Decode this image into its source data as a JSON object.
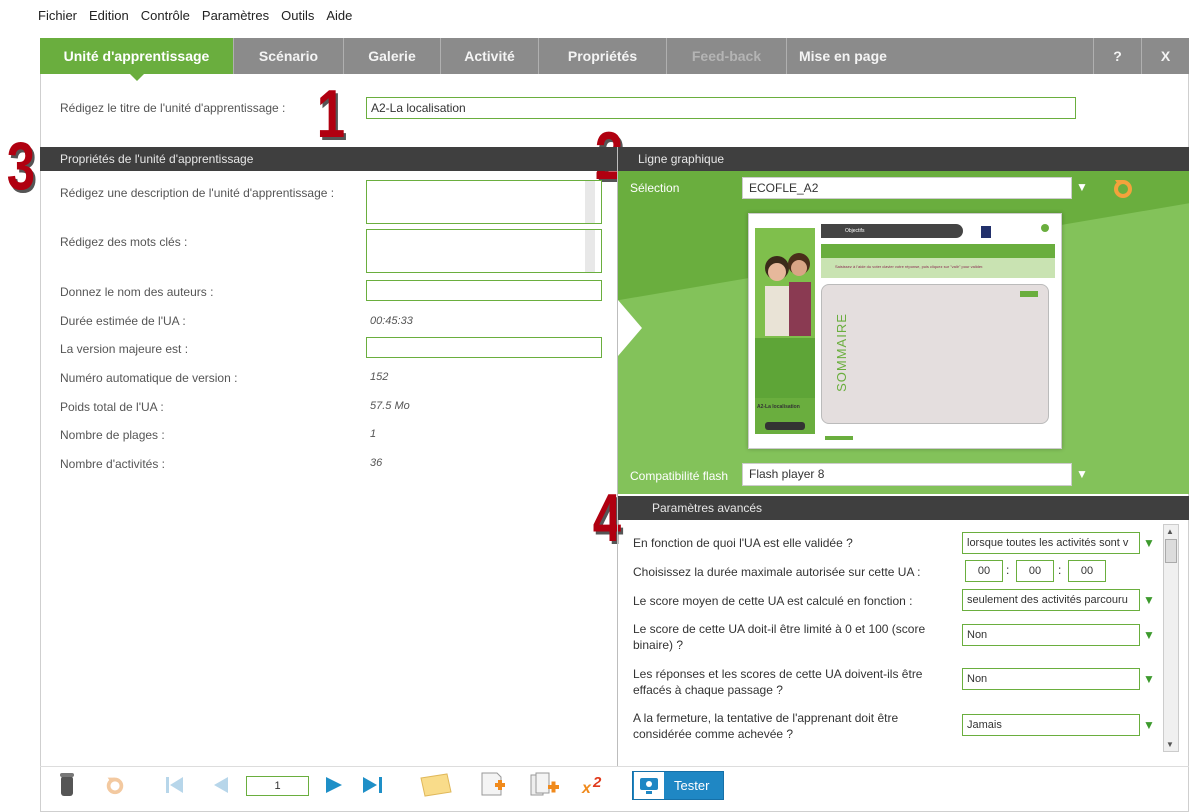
{
  "menu": [
    "Fichier",
    "Edition",
    "Contrôle",
    "Paramètres",
    "Outils",
    "Aide"
  ],
  "tabs": [
    {
      "label": "Unité d'apprentissage",
      "state": "active"
    },
    {
      "label": "Scénario",
      "state": "normal"
    },
    {
      "label": "Galerie",
      "state": "normal"
    },
    {
      "label": "Activité",
      "state": "normal"
    },
    {
      "label": "Propriétés",
      "state": "normal"
    },
    {
      "label": "Feed-back",
      "state": "disabled"
    },
    {
      "label": "Mise en page",
      "state": "normal"
    }
  ],
  "tab_help": "?",
  "tab_close": "X",
  "title_prompt": "Rédigez le titre de l'unité d'apprentissage :",
  "title_value": "A2-La localisation",
  "callouts": [
    "1",
    "2",
    "3",
    "4"
  ],
  "props": {
    "header": "Propriétés de l'unité d'apprentissage",
    "description_label": "Rédigez une description de l'unité d'apprentissage :",
    "keywords_label": "Rédigez des mots clés :",
    "authors_label": "Donnez le nom des auteurs :",
    "duration_label": "Durée estimée de l'UA :",
    "duration_value": "00:45:33",
    "major_label": "La version majeure est :",
    "autoversion_label": "Numéro automatique de version :",
    "autoversion_value": "152",
    "weight_label": "Poids total de l'UA :",
    "weight_value": "57.5 Mo",
    "ranges_label": "Nombre de plages :",
    "ranges_value": "1",
    "activities_label": "Nombre d'activités :",
    "activities_value": "36"
  },
  "graphic": {
    "header": "Ligne graphique",
    "selection_label": "Sélection",
    "selection_value": "ECOFLE_A2",
    "flash_label": "Compatibilité flash",
    "flash_value": "Flash player 8",
    "preview": {
      "objective": "Objectifs",
      "banner_text": "Saisissez à l'aide du voter clavier votre réponse, puis cliquez sur \"valir\" pour valider.",
      "summary": "SOMMAIRE",
      "caption": "A2-La localisation"
    }
  },
  "advanced": {
    "header": "Paramètres avancés",
    "rows": [
      {
        "label": "En fonction de quoi l'UA est elle validée ?",
        "value": "lorsque toutes les activités sont v"
      },
      {
        "label": "Choisissez la durée maximale autorisée sur cette UA :",
        "time": [
          "00",
          "00",
          "00"
        ]
      },
      {
        "label": "Le score moyen de cette UA est calculé en fonction :",
        "value": "seulement des activités parcouru"
      },
      {
        "label": "Le score de cette UA doit-il être limité à 0 et 100 (score binaire) ?",
        "value": "Non"
      },
      {
        "label": "Les réponses et les scores de cette UA doivent-ils être effacés à chaque passage ?",
        "value": "Non"
      },
      {
        "label": "A la fermeture, la tentative de l'apprenant doit être considérée comme achevée ?",
        "value": "Jamais"
      }
    ]
  },
  "toolbar": {
    "page": "1",
    "test_label": "Tester"
  },
  "colors": {
    "green": "#6aae3e",
    "tabbar": "#8b8b8b",
    "header": "#3f3f3f",
    "callout": "#b00010"
  }
}
